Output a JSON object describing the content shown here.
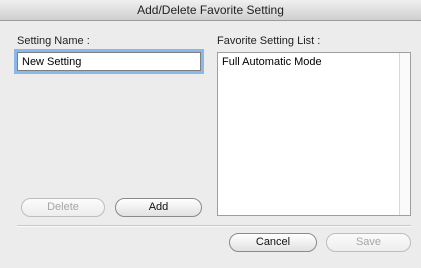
{
  "window": {
    "title": "Add/Delete Favorite Setting"
  },
  "setting_name": {
    "label": "Setting Name :",
    "value": "New Setting"
  },
  "favorite_list": {
    "label": "Favorite Setting List :",
    "items": [
      "Full Automatic Mode"
    ]
  },
  "buttons": {
    "delete": "Delete",
    "add": "Add",
    "cancel": "Cancel",
    "save": "Save"
  }
}
